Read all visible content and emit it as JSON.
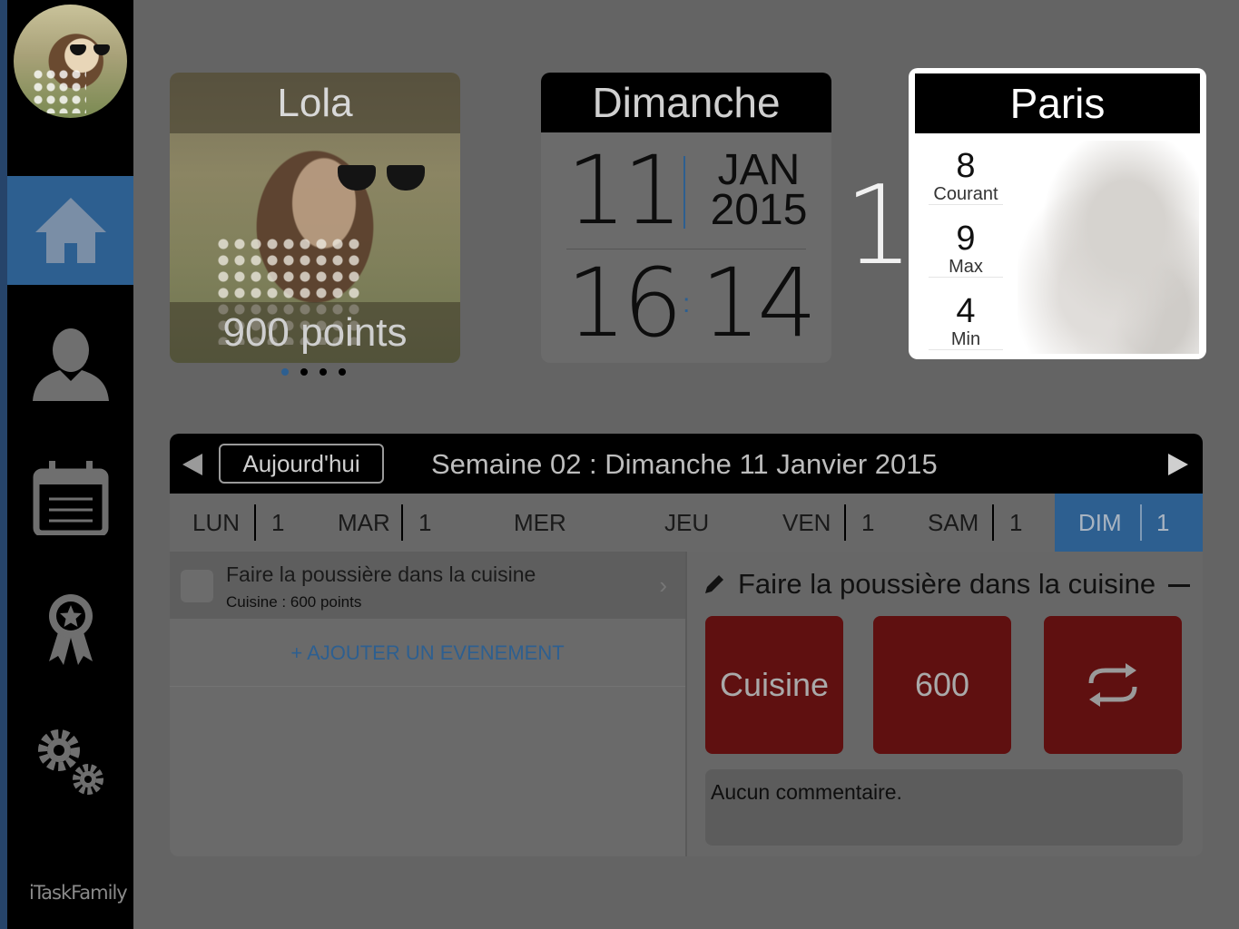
{
  "sidebar": {
    "items": [
      {
        "name": "home",
        "icon": "home-icon",
        "active": true
      },
      {
        "name": "profile",
        "icon": "user-icon",
        "active": false
      },
      {
        "name": "calendar",
        "icon": "calendar-icon",
        "active": false
      },
      {
        "name": "rewards",
        "icon": "award-icon",
        "active": false
      },
      {
        "name": "settings",
        "icon": "gears-icon",
        "active": false
      }
    ],
    "brand": "iTaskFamily"
  },
  "profile": {
    "name": "Lola",
    "points": "900 points",
    "page_count": 4,
    "current_page": 1
  },
  "date": {
    "weekday": "Dimanche",
    "day": "11",
    "month": "JAN",
    "year": "2015",
    "hour": "16",
    "minute": "14"
  },
  "badge_number": "1",
  "weather": {
    "city": "Paris",
    "current": "8",
    "current_label": "Courant",
    "max": "9",
    "max_label": "Max",
    "min": "4",
    "min_label": "Min"
  },
  "calendar": {
    "today_button": "Aujourd'hui",
    "week_title": "Semaine 02 : Dimanche 11 Janvier 2015",
    "days": [
      {
        "label": "LUN",
        "count": "1"
      },
      {
        "label": "MAR",
        "count": "1"
      },
      {
        "label": "MER",
        "count": ""
      },
      {
        "label": "JEU",
        "count": ""
      },
      {
        "label": "VEN",
        "count": "1"
      },
      {
        "label": "SAM",
        "count": "1"
      },
      {
        "label": "DIM",
        "count": "1"
      }
    ],
    "active_day": "DIM",
    "task": {
      "title": "Faire la poussière dans la cuisine",
      "subtitle": "Cuisine : 600 points"
    },
    "add_event": "+ AJOUTER UN EVENEMENT",
    "detail": {
      "title": "Faire la poussière dans la cuisine",
      "category": "Cuisine",
      "points": "600",
      "comment": "Aucun commentaire."
    }
  },
  "colors": {
    "accent": "#2d5f90",
    "tile": "#5f1010",
    "background": "#646464"
  }
}
